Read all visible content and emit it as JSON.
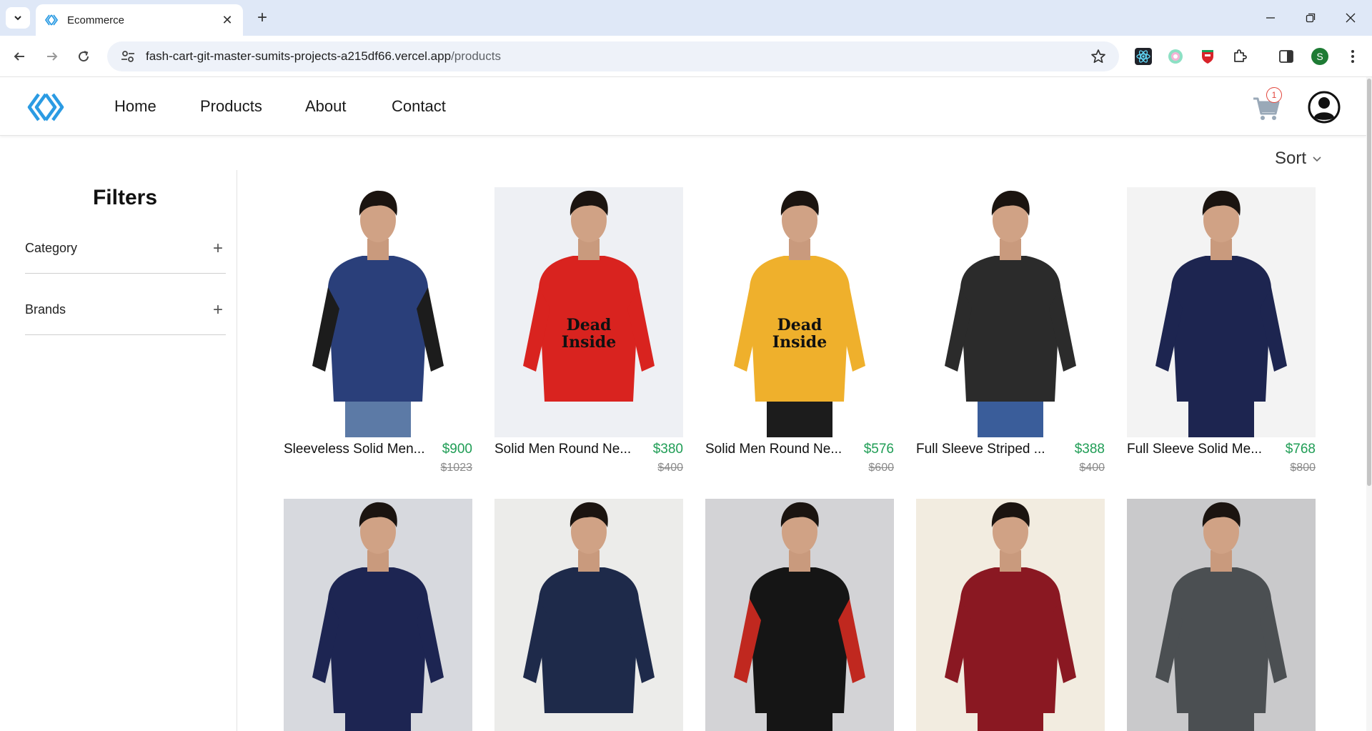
{
  "browser": {
    "tab_title": "Ecommerce",
    "url_host": "fash-cart-git-master-sumits-projects-a215df66.vercel.app",
    "url_path": "/products",
    "profile_initial": "S"
  },
  "header": {
    "nav": [
      "Home",
      "Products",
      "About",
      "Contact"
    ],
    "cart_count": "1"
  },
  "sort": {
    "label": "Sort"
  },
  "filters": {
    "title": "Filters",
    "sections": [
      {
        "label": "Category"
      },
      {
        "label": "Brands"
      }
    ]
  },
  "products": [
    {
      "name": "Sleeveless Solid Men...",
      "price": "$900",
      "old_price": "$1023",
      "bg": "#ffffff",
      "garment": "#2a3f7a",
      "sleeve": "#1c1c1c",
      "pants": "#5c7aa6",
      "print": ""
    },
    {
      "name": "Solid Men Round Ne...",
      "price": "$380",
      "old_price": "$400",
      "bg": "#eef0f4",
      "garment": "#d9231f",
      "sleeve": "#d9231f",
      "pants": "#eef0f4",
      "print": "Dead Inside"
    },
    {
      "name": "Solid Men Round Ne...",
      "price": "$576",
      "old_price": "$600",
      "bg": "#ffffff",
      "garment": "#efb02c",
      "sleeve": "#efb02c",
      "pants": "#1c1c1c",
      "print": "Dead Inside"
    },
    {
      "name": "Full Sleeve Striped ...",
      "price": "$388",
      "old_price": "$400",
      "bg": "#ffffff",
      "garment": "#2b2b2b",
      "sleeve": "#2b2b2b",
      "pants": "#3a5d9a",
      "print": ""
    },
    {
      "name": "Full Sleeve Solid Me...",
      "price": "$768",
      "old_price": "$800",
      "bg": "#f3f3f3",
      "garment": "#1d2550",
      "sleeve": "#1d2550",
      "pants": "#1d2550",
      "print": ""
    },
    {
      "name": "",
      "price": "",
      "old_price": "",
      "bg": "#d7d9de",
      "garment": "#1d2552",
      "sleeve": "#1d2552",
      "pants": "#1d2552",
      "print": ""
    },
    {
      "name": "",
      "price": "",
      "old_price": "",
      "bg": "#ececea",
      "garment": "#1e2a4a",
      "sleeve": "#1e2a4a",
      "pants": "#ececea",
      "print": ""
    },
    {
      "name": "",
      "price": "",
      "old_price": "",
      "bg": "#d3d3d6",
      "garment": "#151515",
      "sleeve": "#c0281f",
      "pants": "#151515",
      "print": ""
    },
    {
      "name": "",
      "price": "",
      "old_price": "",
      "bg": "#f2ece0",
      "garment": "#8a1822",
      "sleeve": "#8a1822",
      "pants": "#8a1822",
      "print": ""
    },
    {
      "name": "",
      "price": "",
      "old_price": "",
      "bg": "#c9c9cb",
      "garment": "#4b4f52",
      "sleeve": "#4b4f52",
      "pants": "#4b4f52",
      "print": ""
    }
  ],
  "colors": {
    "accent": "#2b9be3",
    "price": "#1f9d55",
    "badge": "#e2453c"
  }
}
